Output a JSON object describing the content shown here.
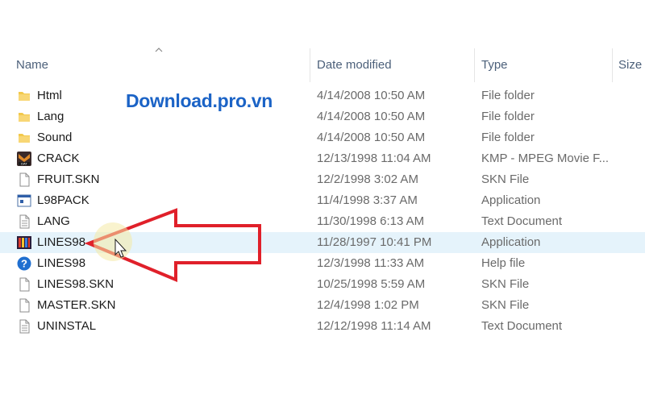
{
  "columns": {
    "name": "Name",
    "date": "Date modified",
    "type": "Type",
    "size": "Size"
  },
  "watermark": "Download.pro.vn",
  "files": [
    {
      "name": "Html",
      "date": "4/14/2008 10:50 AM",
      "type": "File folder",
      "icon": "folder-icon"
    },
    {
      "name": "Lang",
      "date": "4/14/2008 10:50 AM",
      "type": "File folder",
      "icon": "folder-icon"
    },
    {
      "name": "Sound",
      "date": "4/14/2008 10:50 AM",
      "type": "File folder",
      "icon": "folder-icon"
    },
    {
      "name": "CRACK",
      "date": "12/13/1998 11:04 AM",
      "type": "KMP - MPEG Movie F...",
      "icon": "kmp-media-icon"
    },
    {
      "name": "FRUIT.SKN",
      "date": "12/2/1998 3:02 AM",
      "type": "SKN File",
      "icon": "blank-file-icon"
    },
    {
      "name": "L98PACK",
      "date": "11/4/1998 3:37 AM",
      "type": "Application",
      "icon": "application-window-icon"
    },
    {
      "name": "LANG",
      "date": "11/30/1998 6:13 AM",
      "type": "Text Document",
      "icon": "text-document-icon"
    },
    {
      "name": "LINES98",
      "date": "11/28/1997 10:41 PM",
      "type": "Application",
      "icon": "lines98-app-icon"
    },
    {
      "name": "LINES98",
      "date": "12/3/1998 11:33 AM",
      "type": "Help file",
      "icon": "help-icon"
    },
    {
      "name": "LINES98.SKN",
      "date": "10/25/1998 5:59 AM",
      "type": "SKN File",
      "icon": "blank-file-icon"
    },
    {
      "name": "MASTER.SKN",
      "date": "12/4/1998 1:02 PM",
      "type": "SKN File",
      "icon": "blank-file-icon"
    },
    {
      "name": "UNINSTAL",
      "date": "12/12/1998 11:14 AM",
      "type": "Text Document",
      "icon": "text-document-icon"
    }
  ],
  "selected_index": 7,
  "colors": {
    "selection": "#e5f3fb",
    "arrow": "#e0202a",
    "folder": "#f2c94c",
    "header_text": "#4c607a",
    "watermark": "#1b63c6"
  }
}
